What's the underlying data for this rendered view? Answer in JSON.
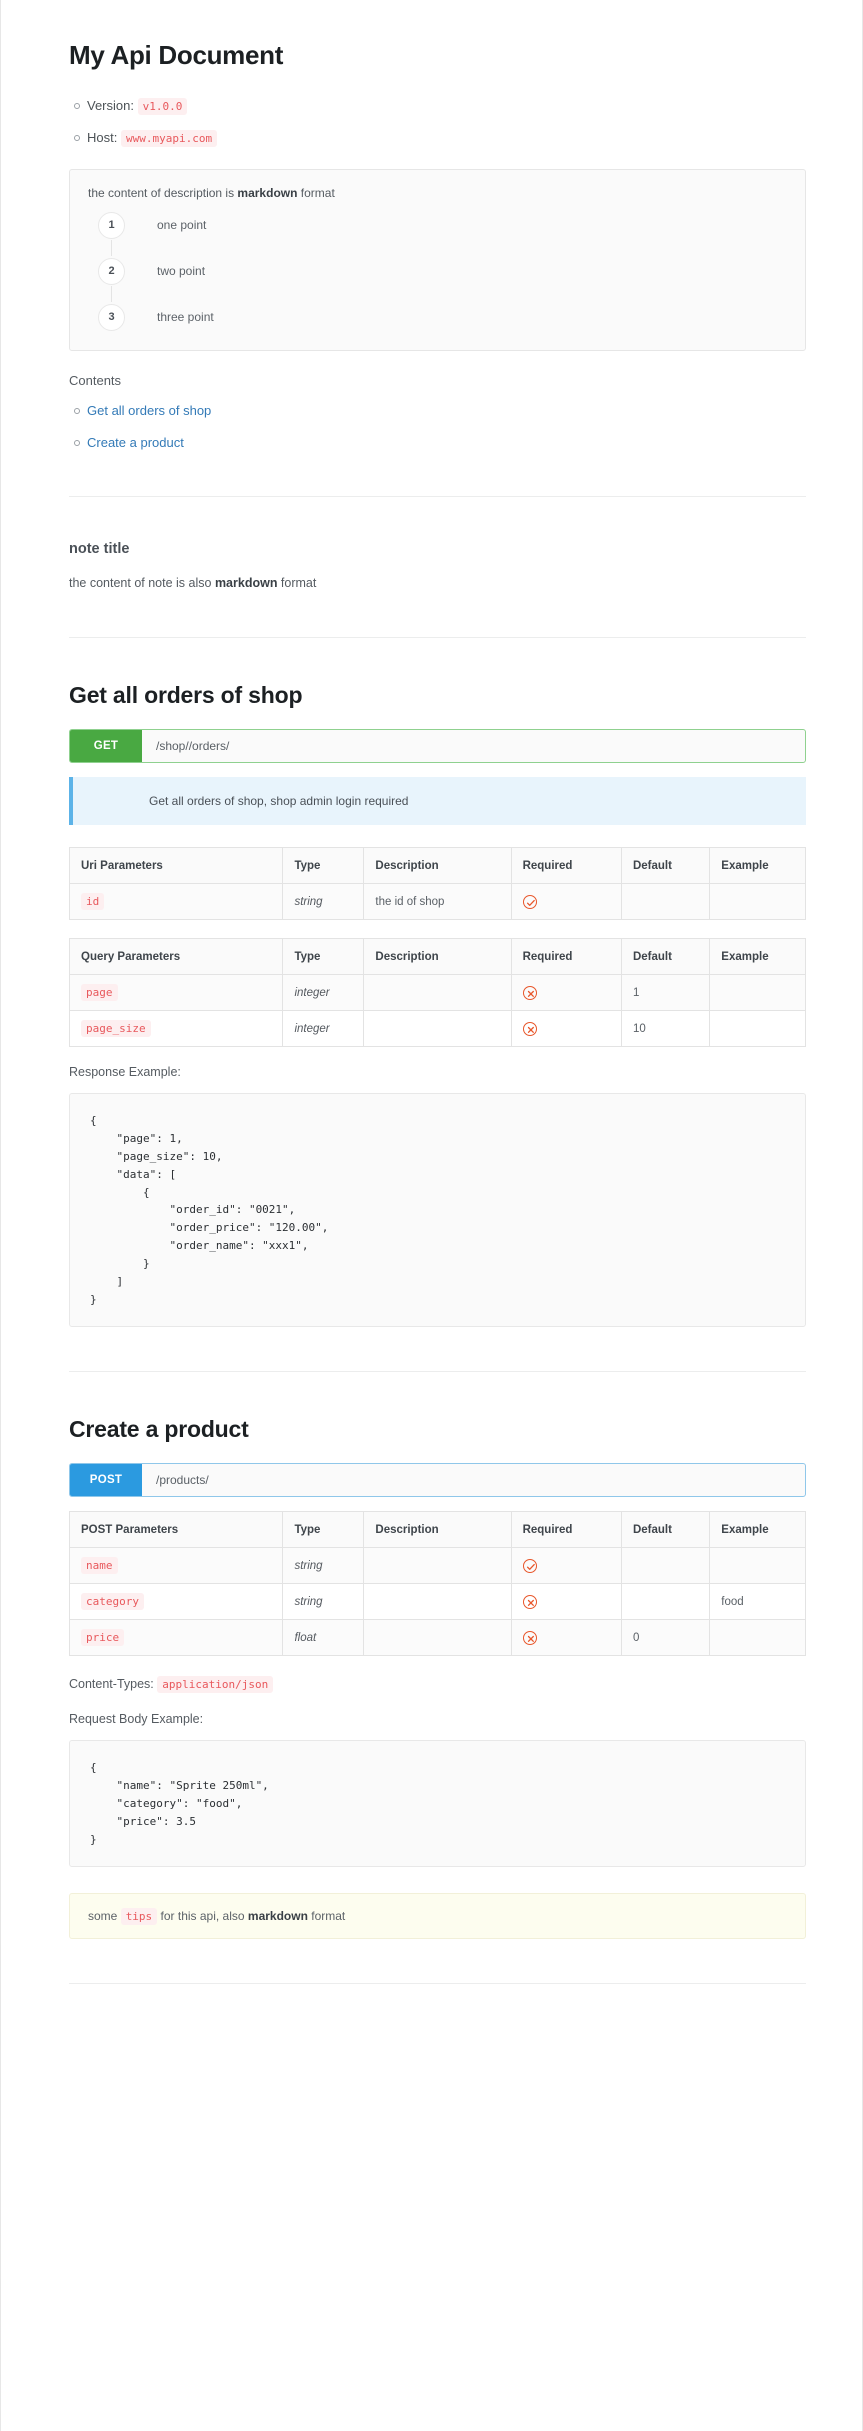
{
  "document": {
    "title": "My Api Document",
    "meta": [
      {
        "label": "Version:",
        "value": "v1.0.0"
      },
      {
        "label": "Host:",
        "value": "www.myapi.com"
      }
    ],
    "description": {
      "intro_prefix": "the content of description is ",
      "intro_strong": "markdown",
      "intro_suffix": " format",
      "steps": [
        {
          "num": "1",
          "text": "one point"
        },
        {
          "num": "2",
          "text": "two point"
        },
        {
          "num": "3",
          "text": "three point"
        }
      ]
    },
    "contents_label": "Contents",
    "contents": [
      {
        "label": "Get all orders of shop"
      },
      {
        "label": "Create a product"
      }
    ],
    "note": {
      "title": "note title",
      "text_prefix": "the content of note is also ",
      "text_strong": "markdown",
      "text_suffix": " format"
    }
  },
  "endpoints": [
    {
      "title": "Get all orders of shop",
      "method": "GET",
      "path": "/shop//orders/",
      "description": "Get all orders of shop, shop admin login required",
      "uri_table": {
        "headers": [
          "Uri Parameters",
          "Type",
          "Description",
          "Required",
          "Default",
          "Example"
        ],
        "rows": [
          {
            "name": "id",
            "type": "string",
            "description": "the id of shop",
            "required": "check",
            "default": "",
            "example": ""
          }
        ]
      },
      "query_table": {
        "headers": [
          "Query Parameters",
          "Type",
          "Description",
          "Required",
          "Default",
          "Example"
        ],
        "rows": [
          {
            "name": "page",
            "type": "integer",
            "description": "",
            "required": "cross",
            "default": "1",
            "example": ""
          },
          {
            "name": "page_size",
            "type": "integer",
            "description": "",
            "required": "cross",
            "default": "10",
            "example": ""
          }
        ]
      },
      "response_label": "Response Example:",
      "response_code": "{\n    \"page\": 1,\n    \"page_size\": 10,\n    \"data\": [\n        {\n            \"order_id\": \"0021\",\n            \"order_price\": \"120.00\",\n            \"order_name\": \"xxx1\",\n        }\n    ]\n}"
    },
    {
      "title": "Create a product",
      "method": "POST",
      "path": "/products/",
      "post_table": {
        "headers": [
          "POST Parameters",
          "Type",
          "Description",
          "Required",
          "Default",
          "Example"
        ],
        "rows": [
          {
            "name": "name",
            "type": "string",
            "description": "",
            "required": "check",
            "default": "",
            "example": ""
          },
          {
            "name": "category",
            "type": "string",
            "description": "",
            "required": "cross",
            "default": "",
            "example": "food"
          },
          {
            "name": "price",
            "type": "float",
            "description": "",
            "required": "cross",
            "default": "0",
            "example": ""
          }
        ]
      },
      "content_types_label": "Content-Types:",
      "content_types_value": "application/json",
      "request_label": "Request Body Example:",
      "request_code": "{\n    \"name\": \"Sprite 250ml\",\n    \"category\": \"food\",\n    \"price\": 3.5\n}",
      "tip": {
        "prefix": "some ",
        "code": "tips",
        "middle": " for this api, also ",
        "strong": "markdown",
        "suffix": " format"
      }
    }
  ],
  "colors": {
    "get_badge": "#49a942",
    "post_badge": "#2b9ae0",
    "link": "#337ab7",
    "code_text": "#e8585c",
    "required_icon": "#e8562a",
    "info_callout_bg": "#e8f4fc",
    "tip_callout_bg": "#fdfdef"
  }
}
